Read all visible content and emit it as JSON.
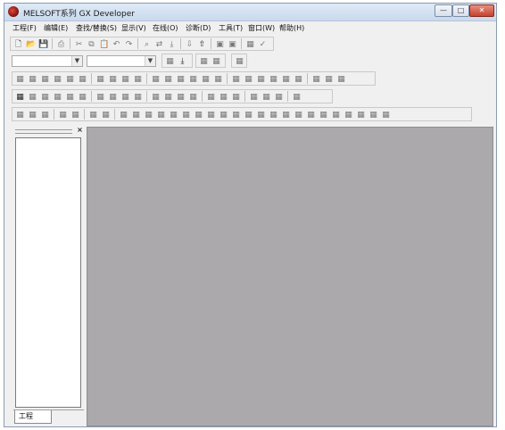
{
  "window": {
    "title": "MELSOFT系列 GX Developer",
    "icon": "melsoft-app-icon"
  },
  "caption_buttons": {
    "minimize": "—",
    "maximize": "□",
    "close": "✕"
  },
  "menu": [
    "工程(F)",
    "编辑(E)",
    "查找/替换(S)",
    "显示(V)",
    "在线(O)",
    "诊断(D)",
    "工具(T)",
    "窗口(W)",
    "帮助(H)"
  ],
  "toolbar_icons": {
    "new": "🗋",
    "open": "📂",
    "save": "💾",
    "print": "⎙",
    "cut": "✂",
    "copy": "⧉",
    "paste": "📋",
    "undo": "↶",
    "redo": "↷",
    "find": "⌕",
    "replace": "⇄",
    "jump": "⤓",
    "write_plc": "⇩",
    "read_plc": "⇧",
    "monitor": "▣",
    "verify": "✓",
    "contact_no": "⊣⊢",
    "contact_nc": "⊣/⊢",
    "coil": "( )",
    "func": "[ ]",
    "line": "─",
    "vline": "│",
    "generic": "▦"
  },
  "project_pane": {
    "close_glyph": "×",
    "tab_label": "工程"
  },
  "colors": {
    "workspace": "#aba9ac",
    "window_bg": "#f0f0f0",
    "titlebar": "#d3e1f1",
    "close_button": "#c4412c"
  }
}
